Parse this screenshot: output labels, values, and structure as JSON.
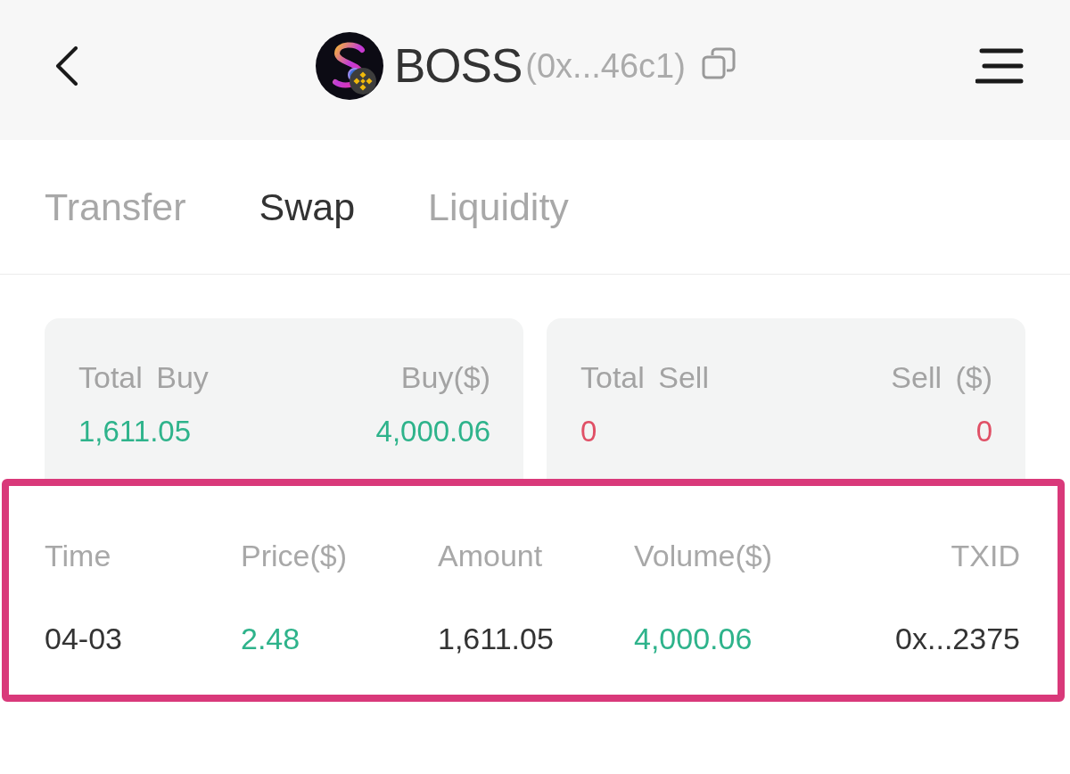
{
  "header": {
    "title": "BOSS",
    "address": "(0x...46c1)"
  },
  "tabs": [
    {
      "label": "Transfer",
      "selected": false
    },
    {
      "label": "Swap",
      "selected": true
    },
    {
      "label": "Liquidity",
      "selected": false
    }
  ],
  "summary_cards": [
    {
      "kind": "buy",
      "left_label": "Total Buy",
      "right_label": "Buy($)",
      "left_value": "1,611.05",
      "right_value": "4,000.06"
    },
    {
      "kind": "sell",
      "left_label": "Total Sell",
      "right_label": "Sell ($)",
      "left_value": "0",
      "right_value": "0"
    }
  ],
  "table": {
    "columns": [
      {
        "label": "Time",
        "kind": "time"
      },
      {
        "label": "Price($)",
        "kind": "price"
      },
      {
        "label": "Amount",
        "kind": "amount"
      },
      {
        "label": "Volume($)",
        "kind": "volume"
      },
      {
        "label": "TXID",
        "kind": "txid"
      }
    ],
    "rows": [
      [
        "04-03",
        "2.48",
        "1,611.05",
        "4,000.06",
        "0x...2375"
      ]
    ]
  }
}
